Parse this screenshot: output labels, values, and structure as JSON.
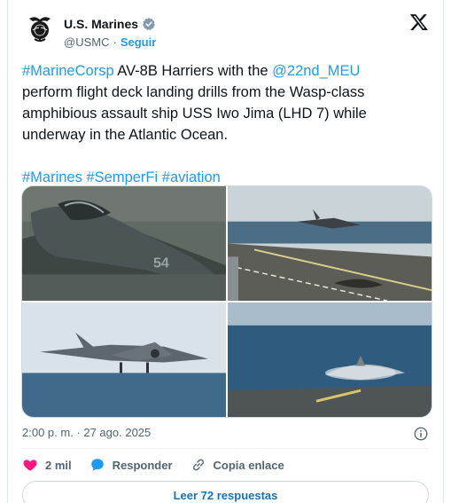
{
  "account": {
    "name": "U.S. Marines",
    "handle": "@USMC",
    "separator": "·",
    "follow_label": "Seguir"
  },
  "tweet": {
    "line1_tag": "#MarineCorsp",
    "line1_text": " AV-8B Harriers with the ",
    "line1_mention": "@22nd_MEU",
    "line2": "perform flight deck landing drills from the Wasp-class",
    "line3": "amphibious assault ship USS Iwo Jima (LHD 7) while",
    "line4": "underway in the Atlantic Ocean.",
    "hashtag1": "#Marines",
    "hashtag2": "#SemperFi",
    "hashtag3": "#aviation"
  },
  "meta": {
    "timestamp": "2:00 p. m. · 27 ago. 2025"
  },
  "actions": {
    "likes_count": "2 mil",
    "reply_label": "Responder",
    "copy_label": "Copia enlace",
    "read_replies_label": "Leer 72 respuestas"
  },
  "icons": {
    "verified": "verified-badge-icon",
    "x_logo": "x-logo-icon",
    "info": "info-icon",
    "heart": "heart-icon",
    "reply": "reply-bubble-icon",
    "link": "link-icon"
  },
  "colors": {
    "accent": "#1d9bf0",
    "heart": "#f91880",
    "text": "#0f1419",
    "muted": "#536471"
  }
}
